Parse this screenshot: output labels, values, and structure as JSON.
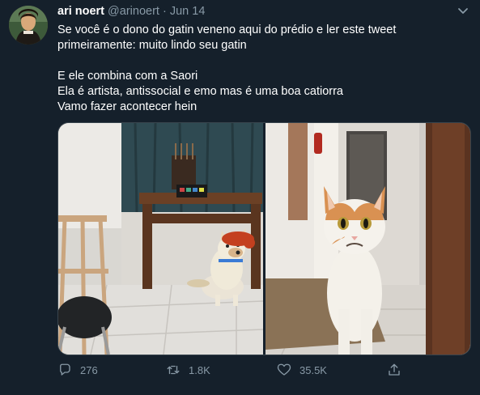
{
  "tweet": {
    "display_name": "ari noert",
    "handle": "@arinoert",
    "separator": "·",
    "date": "Jun 14",
    "text_lines": [
      "Se você é o dono do gatin veneno aqui do prédio e ler este tweet",
      "primeiramente: muito lindo seu gatin",
      "",
      "E ele combina com a Saori",
      "Ela é artista, antissocial e emo mas é uma boa catiorra",
      "Vamo fazer acontecer hein"
    ]
  },
  "actions": {
    "reply_count": "276",
    "retweet_count": "1.8K",
    "like_count": "35.5K"
  },
  "icons": {
    "reply": "reply-icon",
    "retweet": "retweet-icon",
    "like": "heart-icon",
    "share": "share-icon",
    "more": "chevron-down-icon"
  },
  "colors": {
    "background": "#15202b",
    "primary_text": "#ffffff",
    "secondary_text": "#8899a6",
    "border": "#38444d"
  }
}
